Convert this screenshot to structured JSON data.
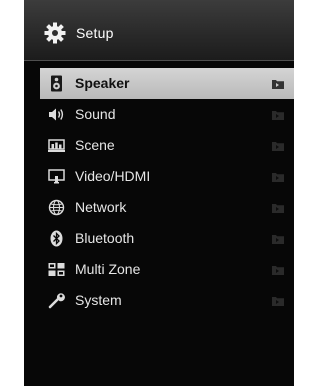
{
  "header": {
    "title": "Setup",
    "icon": "gear-icon"
  },
  "menu": {
    "items": [
      {
        "label": "Speaker",
        "icon": "speaker-icon",
        "selected": true
      },
      {
        "label": "Sound",
        "icon": "sound-icon",
        "selected": false
      },
      {
        "label": "Scene",
        "icon": "scene-icon",
        "selected": false
      },
      {
        "label": "Video/HDMI",
        "icon": "video-icon",
        "selected": false
      },
      {
        "label": "Network",
        "icon": "network-icon",
        "selected": false
      },
      {
        "label": "Bluetooth",
        "icon": "bluetooth-icon",
        "selected": false
      },
      {
        "label": "Multi Zone",
        "icon": "multizone-icon",
        "selected": false
      },
      {
        "label": "System",
        "icon": "wrench-icon",
        "selected": false
      }
    ]
  },
  "colors": {
    "background": "#070707",
    "header": "#2f2f2f",
    "text": "#e6e6e6",
    "selected": "#c8c8c8"
  }
}
